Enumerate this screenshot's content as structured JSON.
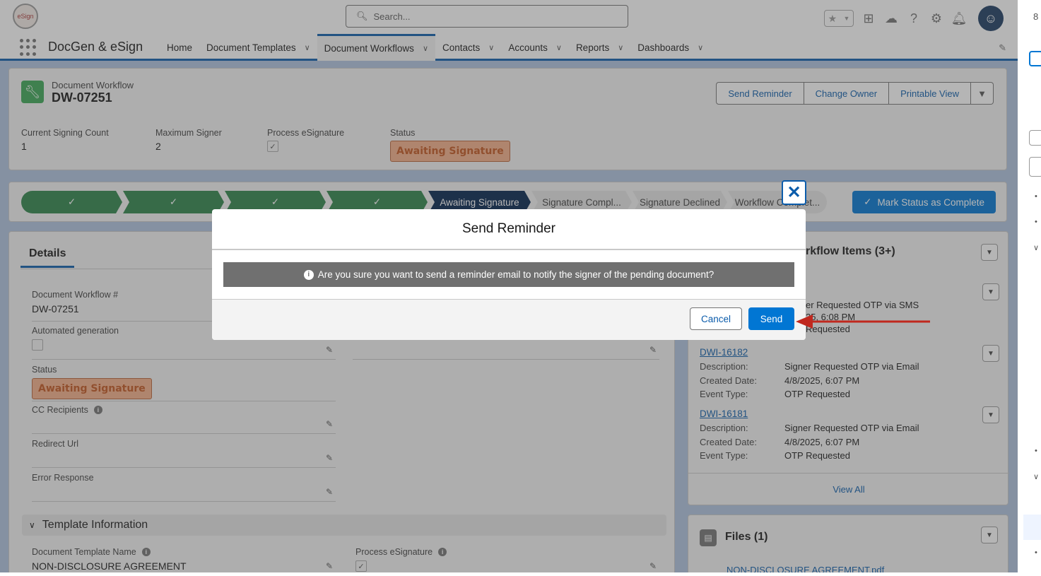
{
  "header": {
    "search_placeholder": "Search...",
    "icons": [
      "favorites-star-icon",
      "add-icon",
      "trailhead-icon",
      "help-icon",
      "setup-gear-icon",
      "notifications-bell-icon",
      "user-avatar"
    ]
  },
  "nav": {
    "app_name": "DocGen & eSign",
    "items": [
      {
        "label": "Home",
        "dropdown": false
      },
      {
        "label": "Document Templates",
        "dropdown": true
      },
      {
        "label": "Document Workflows",
        "dropdown": true,
        "active": true
      },
      {
        "label": "Contacts",
        "dropdown": true
      },
      {
        "label": "Accounts",
        "dropdown": true
      },
      {
        "label": "Reports",
        "dropdown": true
      },
      {
        "label": "Dashboards",
        "dropdown": true
      }
    ]
  },
  "record": {
    "type": "Document Workflow",
    "name": "DW-07251",
    "actions": [
      "Send Reminder",
      "Change Owner",
      "Printable View"
    ],
    "highlights": [
      {
        "label": "Current Signing Count",
        "value": "1"
      },
      {
        "label": "Maximum Signer",
        "value": "2"
      },
      {
        "label": "Process eSignature",
        "value": ""
      },
      {
        "label": "Status",
        "value": "Awaiting Signature"
      }
    ]
  },
  "path": {
    "steps": [
      {
        "label": "✓",
        "state": "done"
      },
      {
        "label": "✓",
        "state": "done"
      },
      {
        "label": "✓",
        "state": "done"
      },
      {
        "label": "✓",
        "state": "done"
      },
      {
        "label": "Awaiting Signature",
        "state": "current"
      },
      {
        "label": "Signature Compl...",
        "state": "upcoming"
      },
      {
        "label": "Signature Declined",
        "state": "upcoming"
      },
      {
        "label": "Workflow Complet...",
        "state": "upcoming"
      }
    ],
    "mark_complete": "Mark Status as Complete"
  },
  "details": {
    "tab": "Details",
    "fields": [
      {
        "label": "Document Workflow #",
        "value": "DW-07251"
      },
      {
        "label": "Automated generation",
        "value": ""
      },
      {
        "label": "Status",
        "value": "Awaiting Signature"
      },
      {
        "label": "CC Recipients",
        "value": ""
      },
      {
        "label": "Redirect Url",
        "value": ""
      },
      {
        "label": "Error Response",
        "value": ""
      }
    ],
    "section": "Template Information",
    "template_fields": [
      {
        "label": "Document Template Name",
        "value": "NON-DISCLOSURE AGREEMENT"
      },
      {
        "label": "Process eSignature",
        "value": ""
      }
    ]
  },
  "related": {
    "title": "rkflow Items (3+)",
    "first_item_fragments": {
      "description": "er Requested OTP via SMS",
      "created": "25, 6:08 PM",
      "event": "Requested"
    },
    "items": [
      {
        "id": "DWI-16182",
        "description": "Signer Requested OTP via Email",
        "created": "4/8/2025, 6:07 PM",
        "event": "OTP Requested"
      },
      {
        "id": "DWI-16181",
        "description": "Signer Requested OTP via Email",
        "created": "4/8/2025, 6:07 PM",
        "event": "OTP Requested"
      }
    ],
    "labels": {
      "description": "Description:",
      "created": "Created Date:",
      "event": "Event Type:"
    },
    "view_all": "View All"
  },
  "files": {
    "title": "Files (1)",
    "file": "NON-DISCLOSURE AGREEMENT.pdf"
  },
  "modal": {
    "title": "Send Reminder",
    "message": "Are you sure you want to send a reminder email to notify the signer of the pending document?",
    "cancel": "Cancel",
    "send": "Send"
  },
  "colors": {
    "brand": "#0176d3",
    "path_done": "#2e844a",
    "path_current": "#03234d",
    "annotation_arrow": "#c0281e"
  }
}
